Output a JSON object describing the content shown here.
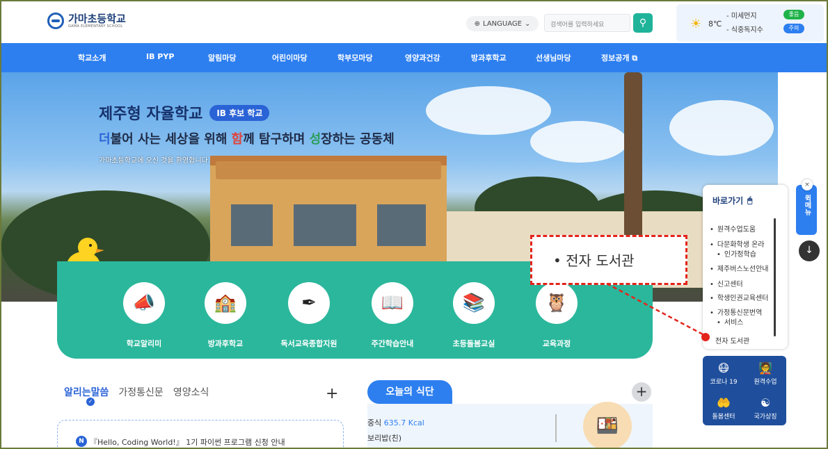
{
  "header": {
    "logo_name": "가마초등학교",
    "logo_sub": "GAMA ELEMENTARY SCHOOL",
    "language_label": "LANGUAGE",
    "search_placeholder": "검색어를 입력하세요",
    "weather": {
      "temperature": "8℃",
      "fine_dust_label": "- 미세먼지",
      "fine_dust_status": "좋음",
      "food_poison_label": "- 식중독지수",
      "food_poison_status": "주의"
    }
  },
  "nav": {
    "items": [
      "학교소개",
      "IB PYP",
      "알림마당",
      "어린이마당",
      "학부모마당",
      "영양과건강",
      "방과후학교",
      "선생님마당",
      "정보공개 ⧉"
    ]
  },
  "hero": {
    "title": "제주형 자율학교",
    "badge": "IB 후보 학교",
    "subtitle_parts": [
      "더",
      "불어 사는 세상을 위해 ",
      "함",
      "께 탐구하며 ",
      "성",
      "장하는 공동체"
    ],
    "welcome": "가마초등학교에 오신 것을 환영합니다."
  },
  "services": [
    {
      "label": "학교알리미",
      "icon": "megaphone-icon"
    },
    {
      "label": "방과후학교",
      "icon": "school-icon"
    },
    {
      "label": "독서교육종합지원",
      "icon": "book-quill-icon"
    },
    {
      "label": "주간학습안내",
      "icon": "open-book-icon"
    },
    {
      "label": "초등돌봄교실",
      "icon": "books-stack-icon"
    },
    {
      "label": "교육과정",
      "icon": "owl-icon"
    }
  ],
  "notices": {
    "tabs": [
      "알리는말씀",
      "가정통신문",
      "영양소식"
    ],
    "item": "『Hello, Coding World!』 1기 파이썬 프로그램 신청 안내",
    "badge": "N"
  },
  "meal": {
    "tab_label": "오늘의 식단",
    "meal_name": "중식",
    "kcal": "635.7 Kcal",
    "dish": "보리밥(친)"
  },
  "shortcut": {
    "title": "바로가기",
    "items": [
      "원격수업도움",
      "다문화학생 온라",
      "인가정학습",
      "제주버스노선안내",
      "신고센터",
      "학생인권교육센터",
      "가정통신문번역",
      "서비스",
      "전자 도서관"
    ]
  },
  "quick_menu": {
    "label": "퀵메뉴",
    "close": "×"
  },
  "icon_grid": [
    {
      "label": "코로나 19",
      "icon": "mask-icon"
    },
    {
      "label": "원격수업",
      "icon": "remote-class-icon"
    },
    {
      "label": "돌봄센터",
      "icon": "care-hand-icon"
    },
    {
      "label": "국가상징",
      "icon": "korea-flag-icon"
    }
  ],
  "callout": {
    "text": "전자 도서관"
  },
  "colors": {
    "nav_blue": "#2d7ff0",
    "band_green": "#2bb79c",
    "callout_red": "#e3241b"
  }
}
